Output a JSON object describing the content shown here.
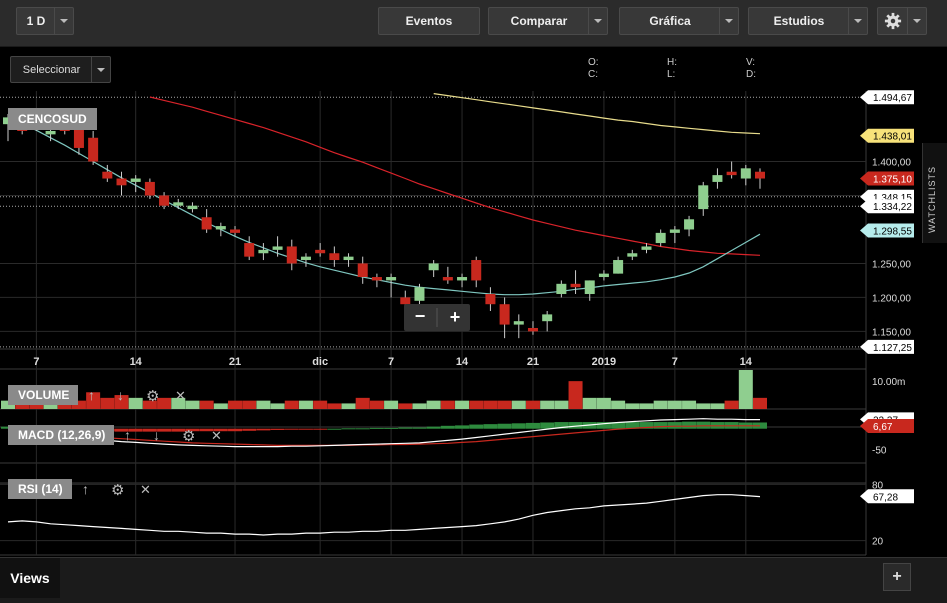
{
  "toolbar": {
    "interval": "1 D",
    "eventos": "Eventos",
    "comparar": "Comparar",
    "grafica": "Gráfica",
    "estudios": "Estudios"
  },
  "select_label": "Seleccionar",
  "ohlc_labels": {
    "o": "O:",
    "h": "H:",
    "v": "V:",
    "c": "C:",
    "l": "L:",
    "d": "D:"
  },
  "watchlists": "WATCHLISTS",
  "views": "Views",
  "plus": "+",
  "zoom": {
    "minus": "−",
    "plus": "+"
  },
  "colors": {
    "up": "#8fce8f",
    "down": "#c8281e",
    "sma_short": "#7fc7c0",
    "sma_mid": "#d9232a",
    "sma_long": "#e8dc8c",
    "grid": "#2a2a2a"
  },
  "chart_data": [
    {
      "type": "candlestick",
      "title": "CENCOSUD",
      "x_ticks": [
        "7",
        "14",
        "21",
        "dic",
        "7",
        "14",
        "21",
        "2019",
        "7",
        "14"
      ],
      "y_ticks": [
        "1.400,00",
        "1.350,00",
        "1.250,00",
        "1.200,00",
        "1.150,00"
      ],
      "ylim": [
        1127,
        1495
      ],
      "price_labels": [
        {
          "text": "1.494,67",
          "value": 1494.67,
          "style": "white"
        },
        {
          "text": "1.438,01",
          "value": 1438.01,
          "style": "yellow"
        },
        {
          "text": "1.375,10",
          "value": 1375.1,
          "style": "red"
        },
        {
          "text": "1.348,15",
          "value": 1348.15,
          "style": "white"
        },
        {
          "text": "1.334,22",
          "value": 1334.22,
          "style": "white"
        },
        {
          "text": "1.298,55",
          "value": 1298.55,
          "style": "cyan"
        },
        {
          "text": "1.127,25",
          "value": 1127.25,
          "style": "white"
        }
      ],
      "ohlc": [
        [
          1455,
          1470,
          1430,
          1465
        ],
        [
          1460,
          1475,
          1440,
          1445
        ],
        [
          1455,
          1470,
          1445,
          1450
        ],
        [
          1440,
          1460,
          1430,
          1445
        ],
        [
          1450,
          1460,
          1440,
          1445
        ],
        [
          1450,
          1465,
          1410,
          1420
        ],
        [
          1435,
          1445,
          1395,
          1400
        ],
        [
          1385,
          1395,
          1370,
          1375
        ],
        [
          1375,
          1385,
          1350,
          1365
        ],
        [
          1370,
          1380,
          1355,
          1375
        ],
        [
          1370,
          1375,
          1345,
          1350
        ],
        [
          1350,
          1355,
          1330,
          1335
        ],
        [
          1335,
          1345,
          1330,
          1340
        ],
        [
          1330,
          1340,
          1325,
          1335
        ],
        [
          1318,
          1330,
          1295,
          1300
        ],
        [
          1300,
          1310,
          1290,
          1305
        ],
        [
          1300,
          1305,
          1290,
          1295
        ],
        [
          1280,
          1290,
          1255,
          1260
        ],
        [
          1265,
          1280,
          1255,
          1270
        ],
        [
          1270,
          1290,
          1260,
          1275
        ],
        [
          1275,
          1285,
          1240,
          1250
        ],
        [
          1255,
          1265,
          1245,
          1260
        ],
        [
          1270,
          1280,
          1260,
          1265
        ],
        [
          1265,
          1275,
          1245,
          1255
        ],
        [
          1255,
          1265,
          1245,
          1260
        ],
        [
          1250,
          1260,
          1220,
          1230
        ],
        [
          1230,
          1235,
          1215,
          1225
        ],
        [
          1225,
          1235,
          1200,
          1230
        ],
        [
          1200,
          1210,
          1185,
          1190
        ],
        [
          1195,
          1220,
          1190,
          1215
        ],
        [
          1240,
          1255,
          1230,
          1250
        ],
        [
          1230,
          1245,
          1220,
          1225
        ],
        [
          1225,
          1235,
          1215,
          1230
        ],
        [
          1255,
          1260,
          1215,
          1225
        ],
        [
          1205,
          1215,
          1180,
          1190
        ],
        [
          1190,
          1200,
          1140,
          1160
        ],
        [
          1160,
          1175,
          1140,
          1165
        ],
        [
          1155,
          1165,
          1145,
          1150
        ],
        [
          1165,
          1180,
          1150,
          1175
        ],
        [
          1205,
          1225,
          1200,
          1220
        ],
        [
          1220,
          1240,
          1205,
          1215
        ],
        [
          1205,
          1225,
          1195,
          1225
        ],
        [
          1230,
          1240,
          1225,
          1235
        ],
        [
          1235,
          1260,
          1235,
          1255
        ],
        [
          1260,
          1270,
          1255,
          1265
        ],
        [
          1270,
          1280,
          1265,
          1275
        ],
        [
          1280,
          1300,
          1275,
          1295
        ],
        [
          1295,
          1305,
          1280,
          1300
        ],
        [
          1300,
          1320,
          1290,
          1315
        ],
        [
          1330,
          1370,
          1320,
          1365
        ],
        [
          1370,
          1390,
          1360,
          1380
        ],
        [
          1385,
          1400,
          1375,
          1380
        ],
        [
          1375,
          1395,
          1365,
          1390
        ],
        [
          1385,
          1390,
          1360,
          1375
        ]
      ],
      "sma_short": [
        1462,
        1455,
        1446,
        1435,
        1424,
        1412,
        1400,
        1388,
        1376,
        1365,
        1354,
        1343,
        1332,
        1321,
        1310,
        1300,
        1290,
        1281,
        1273,
        1265,
        1258,
        1251,
        1245,
        1240,
        1235,
        1230,
        1226,
        1222,
        1218,
        1215,
        1213,
        1211,
        1209,
        1207,
        1205,
        1204,
        1204,
        1205,
        1207,
        1209,
        1212,
        1214,
        1217,
        1219,
        1221,
        1223,
        1226,
        1230,
        1236,
        1245,
        1257,
        1269,
        1281,
        1293
      ],
      "sma_mid": [
        null,
        null,
        null,
        null,
        null,
        null,
        null,
        null,
        null,
        null,
        1495,
        1490,
        1485,
        1480,
        1474,
        1468,
        1462,
        1456,
        1450,
        1443,
        1436,
        1429,
        1421,
        1413,
        1406,
        1399,
        1391,
        1383,
        1375,
        1367,
        1360,
        1353,
        1346,
        1339,
        1332,
        1326,
        1320,
        1314,
        1309,
        1304,
        1299,
        1295,
        1291,
        1287,
        1283,
        1279,
        1275,
        1272,
        1269,
        1267,
        1265,
        1264,
        1263,
        1262
      ],
      "sma_long": [
        null,
        null,
        null,
        null,
        null,
        null,
        null,
        null,
        null,
        null,
        null,
        null,
        null,
        null,
        null,
        null,
        null,
        null,
        null,
        null,
        null,
        null,
        null,
        null,
        null,
        null,
        null,
        null,
        null,
        null,
        1500,
        1497,
        1494,
        1491,
        1488,
        1485,
        1482,
        1479,
        1476,
        1473,
        1470,
        1467,
        1464,
        1461,
        1459,
        1456,
        1453,
        1451,
        1449,
        1447,
        1445,
        1443,
        1442,
        1441
      ]
    },
    {
      "type": "bar",
      "title": "VOLUME",
      "y_ticks": [
        "10.00m"
      ],
      "ylim": [
        0,
        14
      ],
      "values": [
        3,
        4,
        3,
        4,
        4,
        3,
        6,
        4,
        5,
        4,
        3,
        4,
        4,
        3,
        3,
        2,
        3,
        3,
        3,
        2,
        3,
        3,
        3,
        2,
        2,
        4,
        3,
        3,
        2,
        2,
        3,
        3,
        3,
        3,
        3,
        3,
        3,
        3,
        3,
        3,
        10,
        4,
        4,
        3,
        2,
        2,
        3,
        3,
        3,
        2,
        2,
        3,
        14,
        4
      ]
    },
    {
      "type": "line",
      "title": "MACD (12,26,9)",
      "y_ticks": [
        "-50"
      ],
      "ylim": [
        -80,
        45
      ],
      "value_labels": [
        {
          "text": "22,37",
          "value": 22.37,
          "style": "white"
        },
        {
          "text": "6,67",
          "value": 6.67,
          "style": "red"
        }
      ],
      "macd": [
        -5,
        -8,
        -11,
        -14,
        -18,
        -22,
        -25,
        -28,
        -31,
        -33,
        -35,
        -37,
        -39,
        -40,
        -41,
        -42,
        -43,
        -43,
        -43,
        -43,
        -42,
        -42,
        -41,
        -40,
        -39,
        -38,
        -37,
        -36,
        -35,
        -34,
        -31,
        -28,
        -25,
        -21,
        -17,
        -13,
        -9,
        -5,
        -1,
        3,
        6,
        9,
        12,
        15,
        17,
        19,
        21,
        22,
        23,
        24,
        23,
        23,
        22,
        22
      ],
      "signal": [
        -10,
        -11,
        -12,
        -14,
        -16,
        -18,
        -20,
        -22,
        -24,
        -26,
        -28,
        -30,
        -32,
        -34,
        -35,
        -36,
        -37,
        -38,
        -39,
        -40,
        -40,
        -40,
        -40,
        -40,
        -40,
        -39,
        -39,
        -38,
        -38,
        -37,
        -36,
        -35,
        -33,
        -31,
        -28,
        -25,
        -22,
        -19,
        -16,
        -13,
        -10,
        -7,
        -4,
        -1,
        1,
        3,
        5,
        6,
        6,
        7,
        7,
        7,
        7,
        7
      ],
      "histogram": [
        5,
        3,
        1,
        0,
        -2,
        -4,
        -5,
        -6,
        -7,
        -7,
        -7,
        -7,
        -7,
        -6,
        -6,
        -6,
        -6,
        -5,
        -4,
        -3,
        -2,
        -2,
        -1,
        0,
        1,
        1,
        2,
        2,
        3,
        3,
        5,
        7,
        8,
        10,
        11,
        12,
        13,
        14,
        15,
        16,
        16,
        16,
        16,
        16,
        16,
        16,
        16,
        16,
        17,
        17,
        16,
        16,
        15,
        15
      ]
    },
    {
      "type": "line",
      "title": "RSI (14)",
      "y_ticks": [
        "80",
        "20"
      ],
      "ylim": [
        10,
        90
      ],
      "value_labels": [
        {
          "text": "67,28",
          "value": 67.28,
          "style": "white"
        }
      ],
      "values": [
        40,
        41,
        40,
        38,
        37,
        36,
        35,
        34,
        33,
        32,
        31,
        30,
        30,
        29,
        28,
        28,
        27,
        27,
        26,
        27,
        27,
        28,
        28,
        29,
        29,
        30,
        30,
        31,
        31,
        32,
        33,
        34,
        35,
        36,
        38,
        40,
        43,
        47,
        50,
        52,
        54,
        55,
        57,
        58,
        59,
        60,
        62,
        64,
        66,
        68,
        69,
        69,
        68,
        67
      ]
    }
  ]
}
